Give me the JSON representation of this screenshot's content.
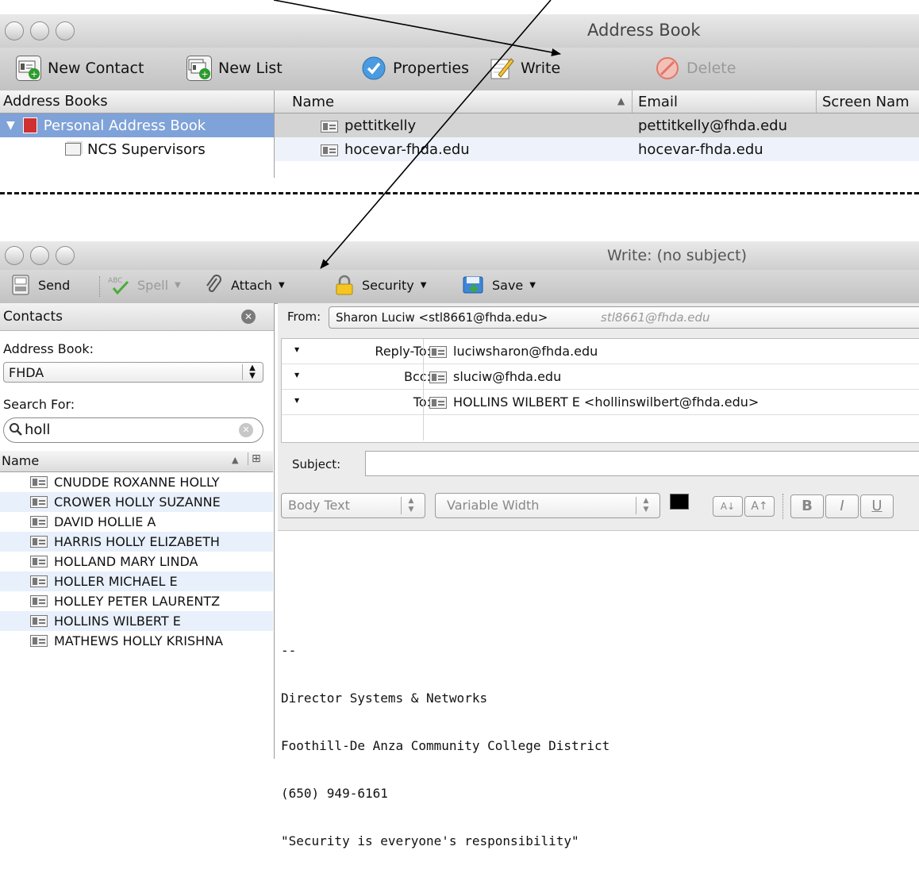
{
  "address_book_window": {
    "title": "Address Book",
    "toolbar": {
      "new_contact": "New Contact",
      "new_list": "New List",
      "properties": "Properties",
      "write": "Write",
      "delete": "Delete"
    },
    "columns": {
      "address_books": "Address Books",
      "name": "Name",
      "email": "Email",
      "screen_name": "Screen Nam"
    },
    "books": [
      {
        "label": "Personal Address Book"
      },
      {
        "label": "NCS Supervisors"
      }
    ],
    "rows": [
      {
        "name": "pettitkelly",
        "email": "pettitkelly@fhda.edu"
      },
      {
        "name": "hocevar-fhda.edu",
        "email": "hocevar-fhda.edu"
      }
    ]
  },
  "write_window": {
    "title": "Write: (no subject)",
    "toolbar": {
      "send": "Send",
      "spell": "Spell",
      "attach": "Attach",
      "security": "Security",
      "save": "Save"
    },
    "sidebar": {
      "title": "Contacts",
      "address_book_label": "Address Book:",
      "address_book_value": "FHDA",
      "search_label": "Search For:",
      "search_value": "holl",
      "name_header": "Name",
      "contacts": [
        "CNUDDE ROXANNE HOLLY",
        "CROWER HOLLY SUZANNE",
        "DAVID HOLLIE A",
        "HARRIS HOLLY ELIZABETH",
        "HOLLAND MARY LINDA",
        "HOLLER MICHAEL E",
        "HOLLEY PETER LAURENTZ",
        "HOLLINS WILBERT E",
        "MATHEWS HOLLY KRISHNA"
      ]
    },
    "from": {
      "label": "From:",
      "value": "Sharon Luciw <stl8661@fhda.edu>",
      "hint": "stl8661@fhda.edu"
    },
    "recipients": [
      {
        "type": "Reply-To:",
        "address": "luciwsharon@fhda.edu"
      },
      {
        "type": "Bcc:",
        "address": "sluciw@fhda.edu"
      },
      {
        "type": "To:",
        "address": "HOLLINS WILBERT E <hollinswilbert@fhda.edu>"
      }
    ],
    "subject_label": "Subject:",
    "format": {
      "paragraph": "Body Text",
      "font": "Variable Width",
      "text_color": "#000000",
      "smaller": "A↓",
      "larger": "A↑",
      "bold": "B",
      "italic": "I",
      "underline": "U"
    },
    "signature": [
      "--",
      "Director Systems & Networks",
      "Foothill-De Anza Community College District",
      "(650) 949-6161",
      "\"Security is everyone's responsibility\""
    ]
  }
}
